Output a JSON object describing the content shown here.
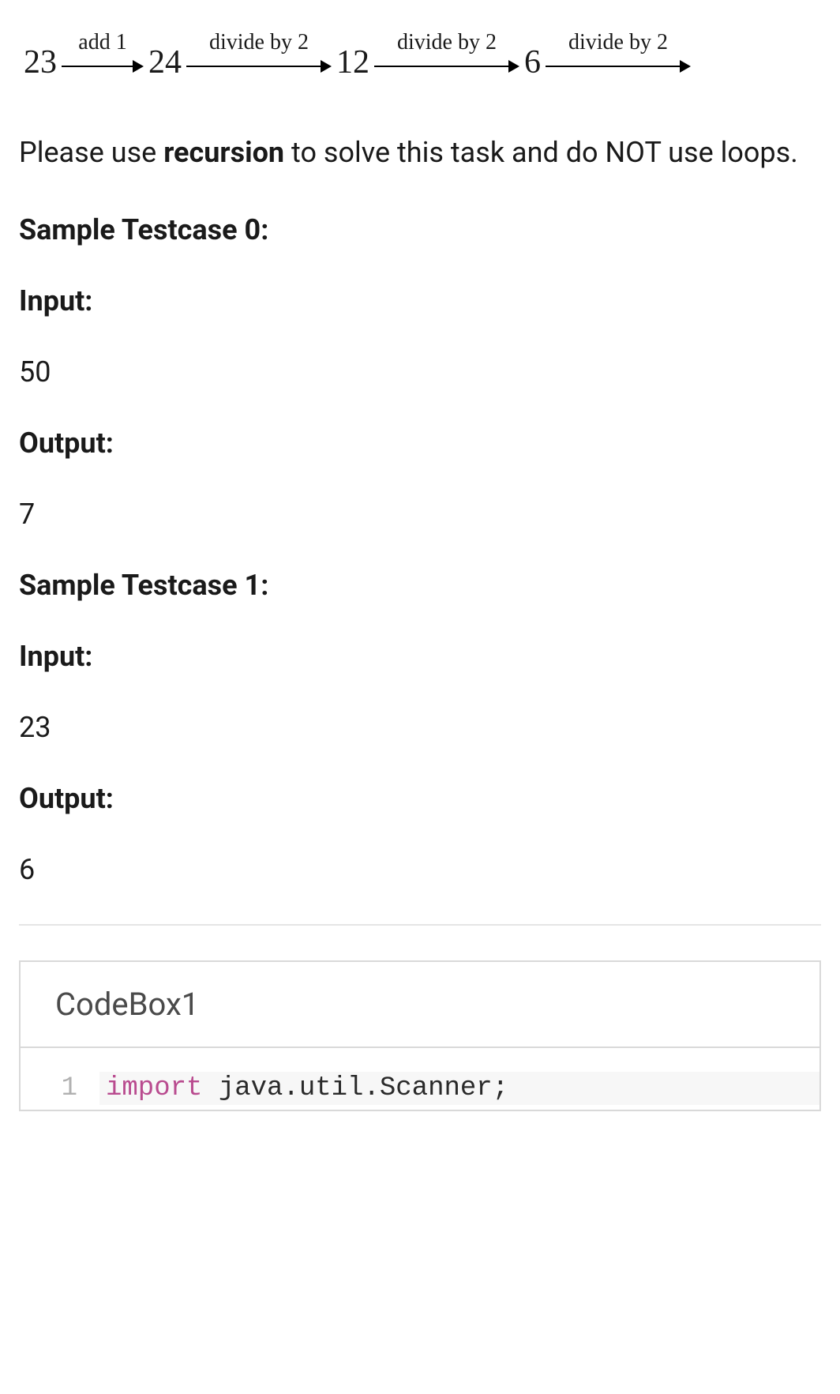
{
  "diagram": {
    "steps": [
      {
        "value": "23",
        "op": "add 1"
      },
      {
        "value": "24",
        "op": "divide by 2"
      },
      {
        "value": "12",
        "op": "divide by 2"
      },
      {
        "value": "6",
        "op": "divide by 2"
      }
    ]
  },
  "instruction": {
    "prefix": "Please use ",
    "emphasis": "recursion",
    "suffix": " to solve this task and do NOT use loops."
  },
  "testcases": [
    {
      "title": "Sample Testcase 0:",
      "input_label": "Input:",
      "input_value": "50",
      "output_label": "Output:",
      "output_value": "7"
    },
    {
      "title": "Sample Testcase 1:",
      "input_label": "Input:",
      "input_value": "23",
      "output_label": "Output:",
      "output_value": "6"
    }
  ],
  "codebox": {
    "title": "CodeBox1",
    "lines": [
      {
        "num": "1",
        "import_kw": "import",
        "rest": " java.util.Scanner;"
      }
    ]
  }
}
